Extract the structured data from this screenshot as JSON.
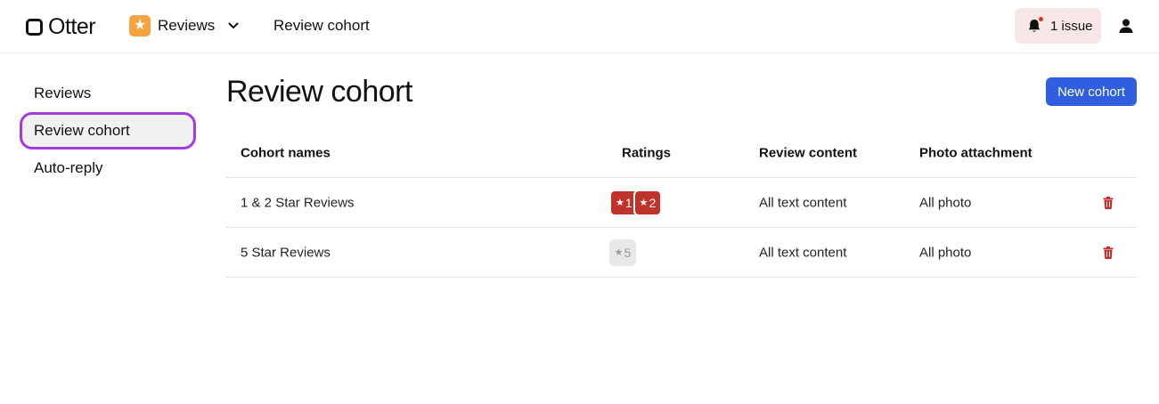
{
  "header": {
    "logo_text": "Otter",
    "app_name": "Reviews",
    "breadcrumb": "Review cohort",
    "issue_label": "1 issue"
  },
  "sidebar": {
    "items": [
      {
        "label": "Reviews"
      },
      {
        "label": "Review cohort"
      },
      {
        "label": "Auto-reply"
      }
    ]
  },
  "main": {
    "title": "Review cohort",
    "new_button": "New cohort",
    "columns": [
      "Cohort names",
      "Ratings",
      "Review content",
      "Photo attachment"
    ],
    "rows": [
      {
        "name": "1 & 2 Star Reviews",
        "ratings": [
          "1",
          "2"
        ],
        "content": "All text content",
        "photo": "All photo"
      },
      {
        "name": "5 Star Reviews",
        "ratings": [
          "5"
        ],
        "content": "All text content",
        "photo": "All photo"
      }
    ]
  },
  "colors": {
    "accent": "#2f5fe0",
    "active_outline": "#a23be0",
    "rating_low": "#c0332a",
    "rating_neutral": "#e8e8e8",
    "app_icon": "#f4a340"
  }
}
